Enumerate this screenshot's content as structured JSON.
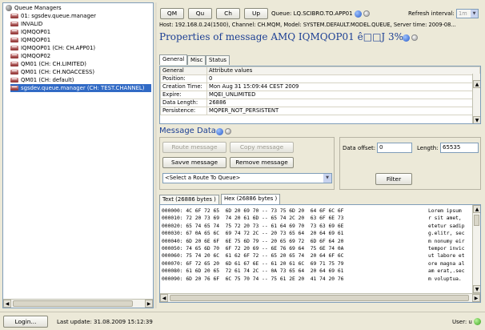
{
  "tree": {
    "root": "Queue Managers",
    "items": [
      "01: sgsdev.queue.manager",
      "INVALID",
      "IQMQOP01",
      "IQMQOP01",
      "IQMQOP01 (CH: CH.APP01)",
      "IQMQOP02",
      "QM01 (CH: CH.LIMITED)",
      "QM01 (CH: CH.NOACCESS)",
      "QM01 (CH: default)",
      "sgsdev.queue.manager (CH: TEST.CHANNEL)"
    ],
    "selected_index": 9
  },
  "toolbar": {
    "qm": "QM",
    "qu": "Qu",
    "ch": "Ch",
    "up": "Up",
    "queue_text": "Queue: LQ.SCIBRO.TO.APP01",
    "refresh_label": "Refresh interval:",
    "refresh_value": "1m"
  },
  "host_line": "Host: 192.168.0.24(1500), Channel: CH.MQM, Model: SYSTEM.DEFAULT.MODEL.QUEUE, Server time: 2009-08...",
  "properties": {
    "title": "Properties of message AMQ IQMQOP01    ê□□J 3%a - 1",
    "tabs": [
      "General",
      "Misc",
      "Status"
    ],
    "columns": [
      "General",
      "Attribute values"
    ],
    "rows": [
      [
        "Position:",
        "0"
      ],
      [
        "Creation Time:",
        "Mon Aug 31 15:09:44 CEST 2009"
      ],
      [
        "Expire:",
        "MQEI_UNLIMITED"
      ],
      [
        "Data Length:",
        "26886"
      ],
      [
        "Persistence:",
        "MQPER_NOT_PERSISTENT"
      ]
    ]
  },
  "message_data": {
    "title": "Message Data",
    "route_btn": "Route message",
    "copy_btn": "Copy message",
    "save_btn": "Savve message",
    "remove_btn": "Remove message",
    "select_placeholder": "<Select a Route To Queue>",
    "offset_label": "Data offset:",
    "offset_value": "0",
    "length_label": "Length:",
    "length_value": "65535",
    "filter_btn": "Filter",
    "tabs": [
      "Text (26886 bytes )",
      "Hex (26886 bytes )"
    ],
    "hex_rows": [
      "000000: 4C 6F 72 65  6D 20 69 70 -- 73 75 6D 20  64 6F 6C 6F",
      "000010: 72 20 73 69  74 20 61 6D -- 65 74 2C 20  63 6F 6E 73",
      "000020: 65 74 65 74  75 72 20 73 -- 61 64 69 70  73 63 69 6E",
      "000030: 67 0A 65 6C  69 74 72 2C -- 20 73 65 64  20 64 69 61",
      "000040: 6D 20 6E 6F  6E 75 6D 79 -- 20 65 69 72  6D 6F 64 20",
      "000050: 74 65 6D 70  6F 72 20 69 -- 6E 76 69 64  75 6E 74 0A",
      "000060: 75 74 20 6C  61 62 6F 72 -- 65 20 65 74  20 64 6F 6C",
      "000070: 6F 72 65 20  6D 61 67 6E -- 61 20 61 6C  69 71 75 79",
      "000080: 61 6D 20 65  72 61 74 2C -- 0A 73 65 64  20 64 69 61",
      "000090: 6D 20 76 6F  6C 75 70 74 -- 75 61 2E 20  41 74 20 76"
    ],
    "text_rows": [
      "Lorem ipsum",
      "r sit amet,",
      "etetur sadip",
      "g.elitr, sec",
      "m nonumy eir",
      "tempor invic",
      "ut labore et",
      "ore magna al",
      "am erat,.sec",
      "m voluptua."
    ]
  },
  "status": {
    "login": "Login...",
    "last_update": "Last update: 31.08.2009 15:12:39",
    "user": "User: u"
  }
}
